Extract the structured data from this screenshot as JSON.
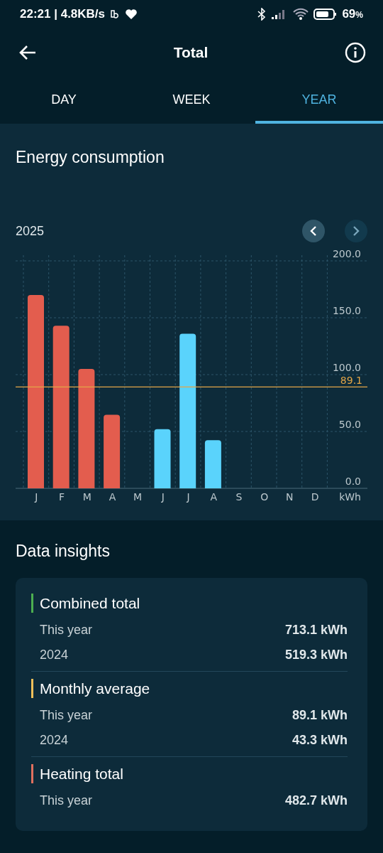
{
  "status_bar": {
    "time": "22:21 | 4.8KB/s",
    "battery": "69",
    "battery_unit": "%"
  },
  "header": {
    "title": "Total"
  },
  "tabs": [
    {
      "label": "DAY",
      "selected": false
    },
    {
      "label": "WEEK",
      "selected": false
    },
    {
      "label": "YEAR",
      "selected": true
    }
  ],
  "energy": {
    "title": "Energy consumption",
    "period": "2025",
    "prev": {
      "disabled": false
    },
    "next": {
      "disabled": true
    },
    "chart_data": {
      "type": "bar",
      "categories": [
        "J",
        "F",
        "M",
        "A",
        "M",
        "J",
        "J",
        "A",
        "S",
        "O",
        "N",
        "D"
      ],
      "ylabel": "kWh",
      "ylim": [
        0,
        200
      ],
      "yticks": [
        {
          "value": 0,
          "label": "0.0"
        },
        {
          "value": 50,
          "label": "50.0"
        },
        {
          "value": 100,
          "label": "100.0"
        },
        {
          "value": 150,
          "label": "150.0"
        },
        {
          "value": 200,
          "label": "200.0"
        }
      ],
      "series": [
        {
          "color": "#e35d4e",
          "values": [
            170,
            143,
            105,
            64.7,
            0,
            0,
            0,
            0,
            0,
            0,
            0,
            0
          ]
        },
        {
          "color": "#5ad3fc",
          "values": [
            0,
            0,
            0,
            0,
            0,
            52,
            136,
            42.4,
            0,
            0,
            0,
            0
          ]
        }
      ],
      "grid": true,
      "ref_lines": [
        {
          "axis": "y",
          "value": 89.1,
          "label": "89.1",
          "color": "#e2a547"
        }
      ]
    }
  },
  "insights": {
    "title": "Data insights",
    "groups": [
      {
        "title": "Combined total",
        "color": "#4caf50",
        "rows": [
          {
            "label": "This year",
            "value": "713.1 kWh"
          },
          {
            "label": "2024",
            "value": "519.3 kWh"
          }
        ]
      },
      {
        "title": "Monthly average",
        "color": "#f0c05a",
        "rows": [
          {
            "label": "This year",
            "value": "89.1 kWh"
          },
          {
            "label": "2024",
            "value": "43.3 kWh"
          }
        ]
      },
      {
        "title": "Heating total",
        "color": "#e0705e",
        "rows": [
          {
            "label": "This year",
            "value": "482.7 kWh"
          }
        ]
      }
    ]
  }
}
